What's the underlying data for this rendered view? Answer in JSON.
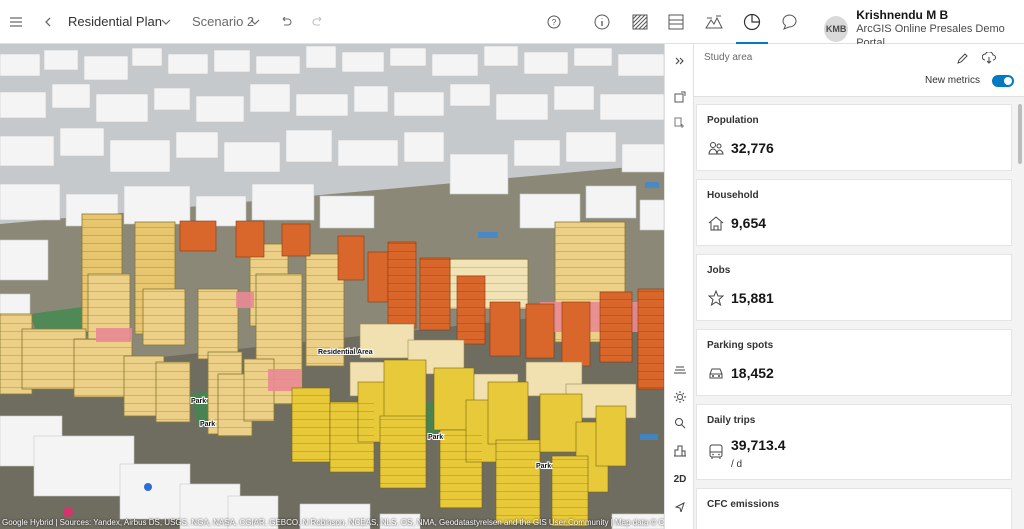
{
  "header": {
    "plan_title": "Residential Plan",
    "scenario": "Scenario 2",
    "icons": [
      "menu-icon",
      "back-icon",
      "undo-icon",
      "redo-icon",
      "help-icon",
      "info-icon",
      "hatch-icon",
      "layout-icon",
      "terrain-icon",
      "dashboard-icon",
      "comment-icon"
    ]
  },
  "user": {
    "initials": "KMB",
    "name": "Krishnendu M B",
    "org": "ArcGIS Online Presales Demo Portal"
  },
  "map": {
    "labels": {
      "residential_area": "Residential Area",
      "park1": "Park",
      "park2": "Park",
      "park3": "Park",
      "park4": "Park"
    },
    "attribution": "Google Hybrid | Sources: Yandex, Airbus DS, USGS, NGA, NASA, CGIAR, GEBCO, N Robinson, NCEAS, NLS, OS, NMA, Geodatastyrelsen and the GIS User Community | Map data © Ope"
  },
  "rail": {
    "view_mode": "2D"
  },
  "panel": {
    "study_area": "Study area",
    "new_metrics_label": "New metrics",
    "new_metrics_on": true,
    "accent": "#007ac2",
    "metrics": [
      {
        "title": "Population",
        "value": "32,776",
        "icon": "people-icon"
      },
      {
        "title": "Household",
        "value": "9,654",
        "icon": "house-icon"
      },
      {
        "title": "Jobs",
        "value": "15,881",
        "icon": "star-icon"
      },
      {
        "title": "Parking spots",
        "value": "18,452",
        "icon": "car-icon"
      },
      {
        "title": "Daily trips",
        "value": "39,713.4",
        "unit": "/ d",
        "icon": "bus-icon"
      },
      {
        "title": "CFC emissions",
        "value": "",
        "icon": ""
      }
    ]
  }
}
